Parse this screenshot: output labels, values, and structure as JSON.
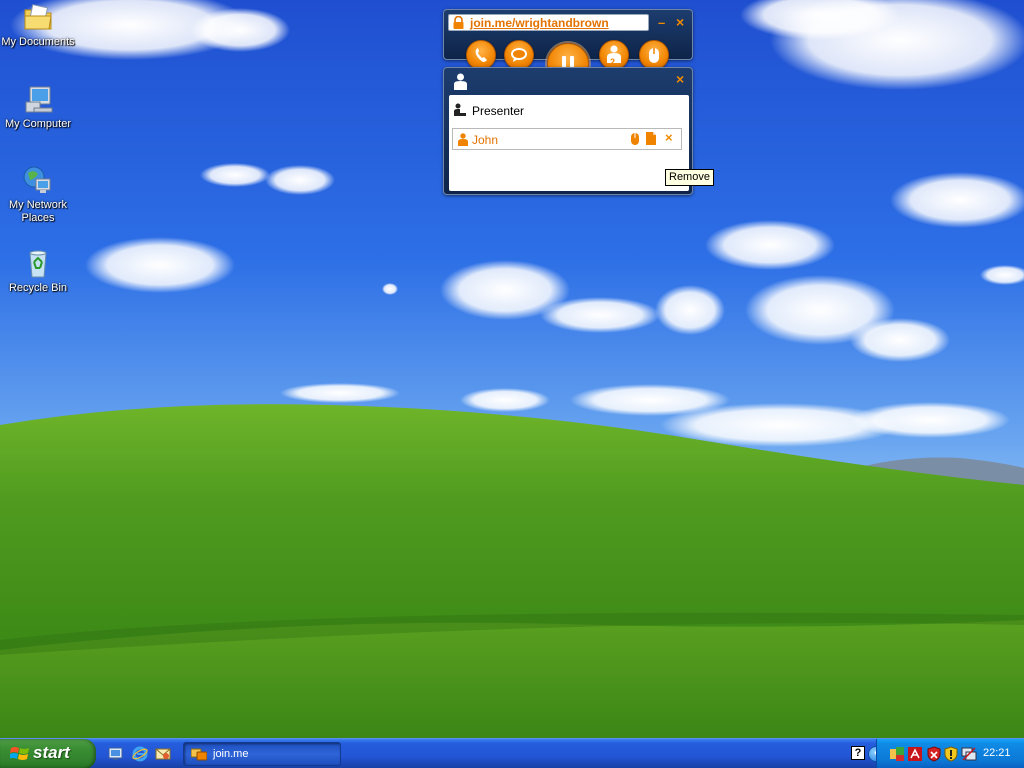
{
  "desktop": {
    "icons": [
      {
        "label": "My Documents",
        "icon": "folder-documents-icon"
      },
      {
        "label": "My Computer",
        "icon": "computer-icon"
      },
      {
        "label": "My Network Places",
        "icon": "network-places-icon"
      },
      {
        "label": "Recycle Bin",
        "icon": "recycle-bin-icon"
      }
    ]
  },
  "joinme": {
    "toolbar": {
      "url": "join.me/wrightandbrown",
      "minimize_label": "–",
      "close_label": "×",
      "buttons": [
        {
          "name": "call",
          "icon": "phone-icon"
        },
        {
          "name": "chat",
          "icon": "chat-icon"
        },
        {
          "name": "pause",
          "icon": "pause-icon"
        },
        {
          "name": "participants",
          "icon": "participants-icon",
          "count": "2"
        },
        {
          "name": "share-control",
          "icon": "mouse-icon"
        }
      ]
    },
    "panel": {
      "close_label": "×",
      "presenter_label": "Presenter",
      "participants": [
        {
          "name": "John",
          "remove_label": "×"
        }
      ],
      "tooltip": "Remove"
    },
    "colors": {
      "accent": "#f08400",
      "link": "#e37300",
      "frame": "#1d3d6e"
    }
  },
  "taskbar": {
    "start_label": "start",
    "quick_launch": [
      "show-desktop-icon",
      "internet-explorer-icon",
      "outlook-express-icon"
    ],
    "tasks": [
      {
        "label": "join.me",
        "icon": "joinme-icon"
      }
    ],
    "help_label": "?",
    "expand_label": "‹",
    "tray_icons": [
      "joinme-tray-icon",
      "acrobat-tray-icon",
      "security-alert-icon",
      "shield-tray-icon",
      "network-tray-icon"
    ],
    "clock": "22:21"
  }
}
